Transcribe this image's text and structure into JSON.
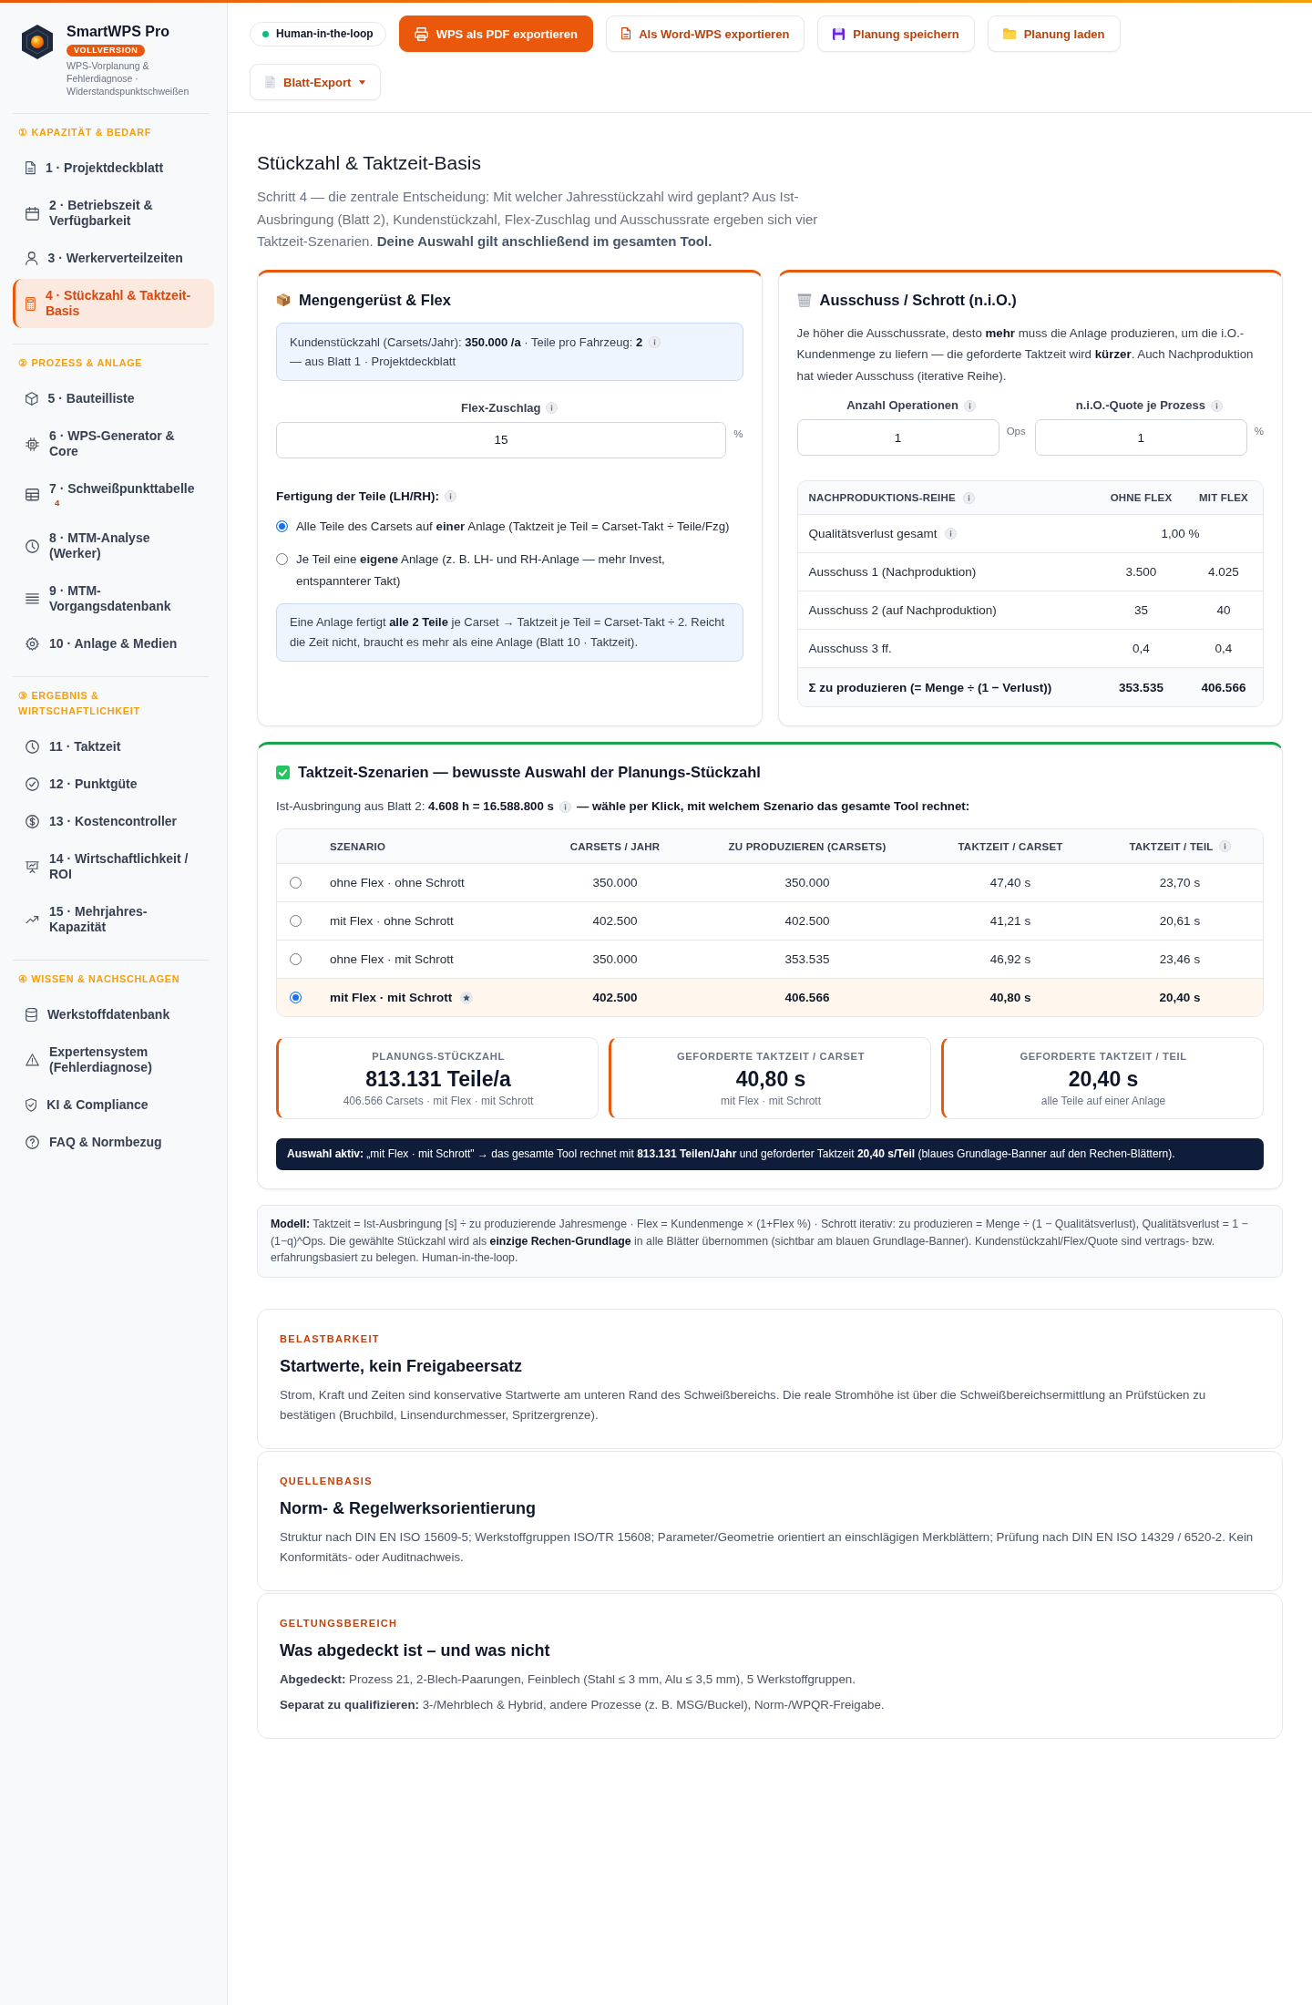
{
  "sidebar": {
    "brand": {
      "title": "SmartWPS Pro",
      "badge": "VOLLVERSION",
      "subtitle": "WPS-Vorplanung & Fehlerdiagnose · Widerstandspunktschweißen"
    },
    "sections": [
      {
        "title": "① KAPAZITÄT & BEDARF",
        "items": [
          {
            "label": "1 · Projektdeckblatt",
            "selected": false
          },
          {
            "label": "2 · Betriebszeit & Verfügbarkeit",
            "selected": false
          },
          {
            "label": "3 · Werkerverteilzeiten",
            "selected": false
          },
          {
            "label": "4 · Stückzahl & Taktzeit-Basis",
            "selected": true
          }
        ]
      },
      {
        "title": "② PROZESS & ANLAGE",
        "items": [
          {
            "label": "5 · Bauteilliste",
            "selected": false
          },
          {
            "label": "6 · WPS-Generator & Core",
            "selected": false
          },
          {
            "label": "7 · Schweißpunkttabelle",
            "badge": "4",
            "selected": false
          },
          {
            "label": "8 · MTM-Analyse (Werker)",
            "selected": false
          },
          {
            "label": "9 · MTM-Vorgangsdatenbank",
            "selected": false
          },
          {
            "label": "10 · Anlage & Medien",
            "selected": false
          }
        ]
      },
      {
        "title": "③ ERGEBNIS & WIRTSCHAFTLICHKEIT",
        "items": [
          {
            "label": "11 · Taktzeit",
            "selected": false
          },
          {
            "label": "12 · Punktgüte",
            "selected": false
          },
          {
            "label": "13 · Kostencontroller",
            "selected": false
          },
          {
            "label": "14 · Wirtschaftlichkeit / ROI",
            "selected": false
          },
          {
            "label": "15 · Mehrjahres-Kapazität",
            "selected": false
          }
        ]
      },
      {
        "title": "④ WISSEN & NACHSCHLAGEN",
        "items": [
          {
            "label": "Werkstoffdatenbank",
            "selected": false
          },
          {
            "label": "Expertensystem (Fehlerdiagnose)",
            "selected": false
          },
          {
            "label": "KI & Compliance",
            "selected": false
          },
          {
            "label": "FAQ & Normbezug",
            "selected": false
          }
        ]
      }
    ]
  },
  "toolbar": {
    "buttons": [
      {
        "kind": "status",
        "label": "Human-in-the-loop"
      },
      {
        "kind": "primary",
        "label": "WPS als PDF exportieren"
      },
      {
        "kind": "secondary",
        "label": "Als Word-WPS exportieren"
      },
      {
        "kind": "secondary",
        "label": "Planung speichern"
      },
      {
        "kind": "secondary",
        "label": "Planung laden"
      },
      {
        "kind": "dropdown",
        "label": "Blatt-Export"
      }
    ]
  },
  "page": {
    "title": "Stückzahl & Taktzeit-Basis",
    "intro": "Schritt 4 — die zentrale Entscheidung: Mit welcher Jahresstückzahl wird geplant? Aus Ist-Ausbringung (Blatt 2), Kundenstückzahl, Flex-Zuschlag und Ausschussrate ergeben sich vier Taktzeit-Szenarien. **Deine Auswahl gilt anschließend im gesamten Tool.**"
  },
  "quantity_card": {
    "title": "Mengengerüst & Flex",
    "source_note": {
      "text": "Kundenstückzahl (Carsets/Jahr): **350.000 /a** · Teile pro Fahrzeug: **2**",
      "info": true,
      "suffix": "— aus Blatt 1 · Projektdeckblatt"
    },
    "flex_field": {
      "label": "Flex-Zuschlag",
      "info": true,
      "value": "15",
      "unit": "%"
    },
    "production": {
      "label": "Fertigung der Teile (LH/RH):",
      "info": true,
      "options": [
        {
          "text": "Alle Teile des Carsets auf **einer** Anlage (Taktzeit je Teil = Carset-Takt ÷ Teile/Fzg)",
          "selected": true
        },
        {
          "text": "Je Teil eine **eigene** Anlage (z. B. LH- und RH-Anlage — mehr Invest, entspannterer Takt)",
          "selected": false
        }
      ]
    },
    "hint": "Eine Anlage fertigt **alle 2 Teile** je Carset → Taktzeit je Teil = Carset-Takt ÷ 2. Reicht die Zeit nicht, braucht es mehr als eine Anlage (Blatt 10 · Taktzeit)."
  },
  "scrap_card": {
    "title": "Ausschuss / Schrott (n.i.O.)",
    "text": "Je höher die Ausschussrate, desto **mehr** muss die Anlage produzieren, um die i.O.-Kundenmenge zu liefern — die geforderte Taktzeit wird **kürzer**. Auch Nachproduktion hat wieder Ausschuss (iterative Reihe).",
    "fields": [
      {
        "label": "Anzahl Operationen",
        "info": true,
        "value": "1",
        "unit": "Ops"
      },
      {
        "label": "n.i.O.-Quote je Prozess",
        "info": true,
        "value": "1",
        "unit": "%"
      }
    ],
    "table": {
      "columns": [
        {
          "label": "NACHPRODUKTIONS-REIHE",
          "info": true
        },
        {
          "label": "OHNE FLEX",
          "info": false
        },
        {
          "label": "MIT FLEX",
          "info": false
        }
      ],
      "rows": [
        {
          "kind": "merged",
          "label": "Qualitätsverlust gesamt",
          "info": true,
          "value": "1,00 %"
        },
        {
          "kind": "values",
          "label": "Ausschuss 1 (Nachproduktion)",
          "info": false,
          "values": [
            "3.500",
            "4.025"
          ]
        },
        {
          "kind": "values",
          "label": "Ausschuss 2 (auf Nachproduktion)",
          "info": false,
          "values": [
            "35",
            "40"
          ]
        },
        {
          "kind": "values",
          "label": "Ausschuss 3 ff.",
          "info": false,
          "values": [
            "0,4",
            "0,4"
          ]
        },
        {
          "kind": "total",
          "label": "Σ zu produzieren (= Menge ÷ (1 − Verlust))",
          "info": false,
          "values": [
            "353.535",
            "406.566"
          ]
        }
      ]
    }
  },
  "scenario_card": {
    "title": "Taktzeit-Szenarien — bewusste Auswahl der Planungs-Stückzahl",
    "subtitle": {
      "text": "Ist-Ausbringung aus Blatt 2: **4.608 h = 16.588.800 s**",
      "info": true,
      "suffix": "— wähle per Klick, mit welchem Szenario das gesamte Tool rechnet:"
    },
    "columns": [
      {
        "label": "SZENARIO",
        "info": false
      },
      {
        "label": "CARSETS / JAHR",
        "info": false
      },
      {
        "label": "ZU PRODUZIEREN (CARSETS)",
        "info": false
      },
      {
        "label": "TAKTZEIT / CARSET",
        "info": false
      },
      {
        "label": "TAKTZEIT / TEIL",
        "info": true
      }
    ],
    "rows": [
      {
        "cells": [
          "ohne Flex · ohne Schrott",
          "350.000",
          "350.000",
          "47,40 s",
          "23,70 s"
        ],
        "selected": false,
        "recommended": false
      },
      {
        "cells": [
          "mit Flex · ohne Schrott",
          "402.500",
          "402.500",
          "41,21 s",
          "20,61 s"
        ],
        "selected": false,
        "recommended": false
      },
      {
        "cells": [
          "ohne Flex · mit Schrott",
          "350.000",
          "353.535",
          "46,92 s",
          "23,46 s"
        ],
        "selected": false,
        "recommended": false
      },
      {
        "cells": [
          "mit Flex · mit Schrott",
          "402.500",
          "406.566",
          "40,80 s",
          "20,40 s"
        ],
        "selected": true,
        "recommended": true
      }
    ],
    "stats": [
      {
        "label": "PLANUNGS-STÜCKZAHL",
        "value": "813.131 Teile/a",
        "note": "406.566 Carsets · mit Flex · mit Schrott"
      },
      {
        "label": "GEFORDERTE TAKTZEIT / CARSET",
        "value": "40,80 s",
        "note": "mit Flex · mit Schrott"
      },
      {
        "label": "GEFORDERTE TAKTZEIT / TEIL",
        "value": "20,40 s",
        "note": "alle Teile auf einer Anlage"
      }
    ],
    "banner": "**Auswahl aktiv:** „mit Flex · mit Schrott\" → das gesamte Tool rechnet mit **813.131 Teilen/Jahr** und geforderter Taktzeit **20,40 s/Teil** (blaues Grundlage-Banner auf den Rechen-Blättern)."
  },
  "model_note": "**Modell:** Taktzeit = Ist-Ausbringung [s] ÷ zu produzierende Jahresmenge · Flex = Kundenmenge × (1+Flex %) · Schrott iterativ: zu produzieren = Menge ÷ (1 − Qualitätsverlust), Qualitätsverlust = 1 − (1−q)^Ops. Die gewählte Stückzahl wird als **einzige Rechen-Grundlage** in alle Blätter übernommen (sichtbar am blauen Grundlage-Banner). Kundenstückzahl/Flex/Quote sind vertrags- bzw. erfahrungsbasiert zu belegen. Human-in-the-loop.",
  "info_cards": [
    {
      "eyebrow": "BELASTBARKEIT",
      "title": "Startwerte, kein Freigabeersatz",
      "paragraphs": [
        "Strom, Kraft und Zeiten sind konservative Startwerte am unteren Rand des Schweißbereichs. Die reale Stromhöhe ist über die Schweißbereichsermittlung an Prüfstücken zu bestätigen (Bruchbild, Linsendurchmesser, Spritzergrenze)."
      ]
    },
    {
      "eyebrow": "QUELLENBASIS",
      "title": "Norm- & Regelwerksorientierung",
      "paragraphs": [
        "Struktur nach DIN EN ISO 15609-5; Werkstoffgruppen ISO/TR 15608; Parameter/Geometrie orientiert an einschlägigen Merkblättern; Prüfung nach DIN EN ISO 14329 / 6520-2. Kein Konformitäts- oder Auditnachweis."
      ]
    },
    {
      "eyebrow": "GELTUNGSBEREICH",
      "title": "Was abgedeckt ist – und was nicht",
      "paragraphs": [
        "**Abgedeckt:** Prozess 21, 2-Blech-Paarungen, Feinblech (Stahl ≤ 3 mm, Alu ≤ 3,5 mm), 5 Werkstoffgruppen.",
        "**Separat zu qualifizieren:** 3-/Mehrblech & Hybrid, andere Prozesse (z. B. MSG/Buckel), Norm-/WPQR-Freigabe."
      ]
    }
  ]
}
